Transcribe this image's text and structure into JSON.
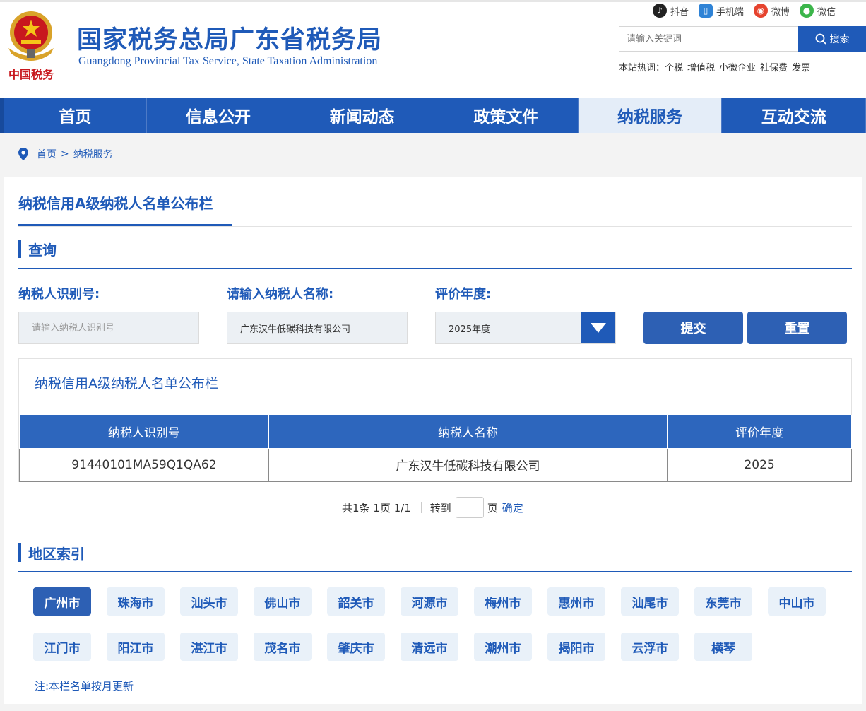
{
  "header": {
    "title": "国家税务总局广东省税务局",
    "subtitle": "Guangdong Provincial Tax Service, State Taxation Administration",
    "emblem_caption": "中国税务",
    "social": [
      {
        "label": "抖音",
        "icon": "douyin-icon",
        "color": "#222222"
      },
      {
        "label": "手机端",
        "icon": "mobile-icon",
        "color": "#2f83d6"
      },
      {
        "label": "微博",
        "icon": "weibo-icon",
        "color": "#e6432e"
      },
      {
        "label": "微信",
        "icon": "wechat-icon",
        "color": "#3bb54a"
      }
    ],
    "search": {
      "placeholder": "请输入关键词",
      "button_label": "搜索"
    },
    "hot": {
      "prefix": "本站热词：",
      "items": [
        "个税",
        "增值税",
        "小微企业",
        "社保费",
        "发票"
      ]
    }
  },
  "nav": {
    "items": [
      {
        "label": "首页"
      },
      {
        "label": "信息公开"
      },
      {
        "label": "新闻动态"
      },
      {
        "label": "政策文件"
      },
      {
        "label": "纳税服务",
        "active": true
      },
      {
        "label": "互动交流"
      }
    ]
  },
  "breadcrumb": {
    "home": "首页",
    "separator": ">",
    "current": "纳税服务"
  },
  "panel": {
    "title": "纳税信用A级纳税人名单公布栏",
    "query_section": "查询",
    "fields": {
      "taxpayer_id_label": "纳税人识别号:",
      "taxpayer_id_placeholder": "请输入纳税人识别号",
      "taxpayer_id_value": "",
      "taxpayer_name_label": "请输入纳税人名称:",
      "taxpayer_name_value": "广东汉牛低碳科技有限公司",
      "year_label": "评价年度:",
      "year_value": "2025年度"
    },
    "buttons": {
      "submit": "提交",
      "reset": "重置"
    },
    "result": {
      "title": "纳税信用A级纳税人名单公布栏",
      "columns": [
        "纳税人识别号",
        "纳税人名称",
        "评价年度"
      ],
      "rows": [
        [
          "91440101MA59Q1QA62",
          "广东汉牛低碳科技有限公司",
          "2025"
        ]
      ]
    },
    "pager": {
      "summary": "共1条 1页 1/1",
      "goto": "转到",
      "page_unit": "页",
      "confirm": "确定"
    },
    "region_section": "地区索引",
    "regions": [
      "广州市",
      "珠海市",
      "汕头市",
      "佛山市",
      "韶关市",
      "河源市",
      "梅州市",
      "惠州市",
      "汕尾市",
      "东莞市",
      "中山市",
      "江门市",
      "阳江市",
      "湛江市",
      "茂名市",
      "肇庆市",
      "清远市",
      "潮州市",
      "揭阳市",
      "云浮市",
      "横琴"
    ],
    "active_region": "广州市",
    "note": "注:本栏名单按月更新"
  },
  "colors": {
    "primary": "#1f5ab8",
    "nav_active_bg": "#e4edf8",
    "region_bg": "#e9f1f9"
  }
}
